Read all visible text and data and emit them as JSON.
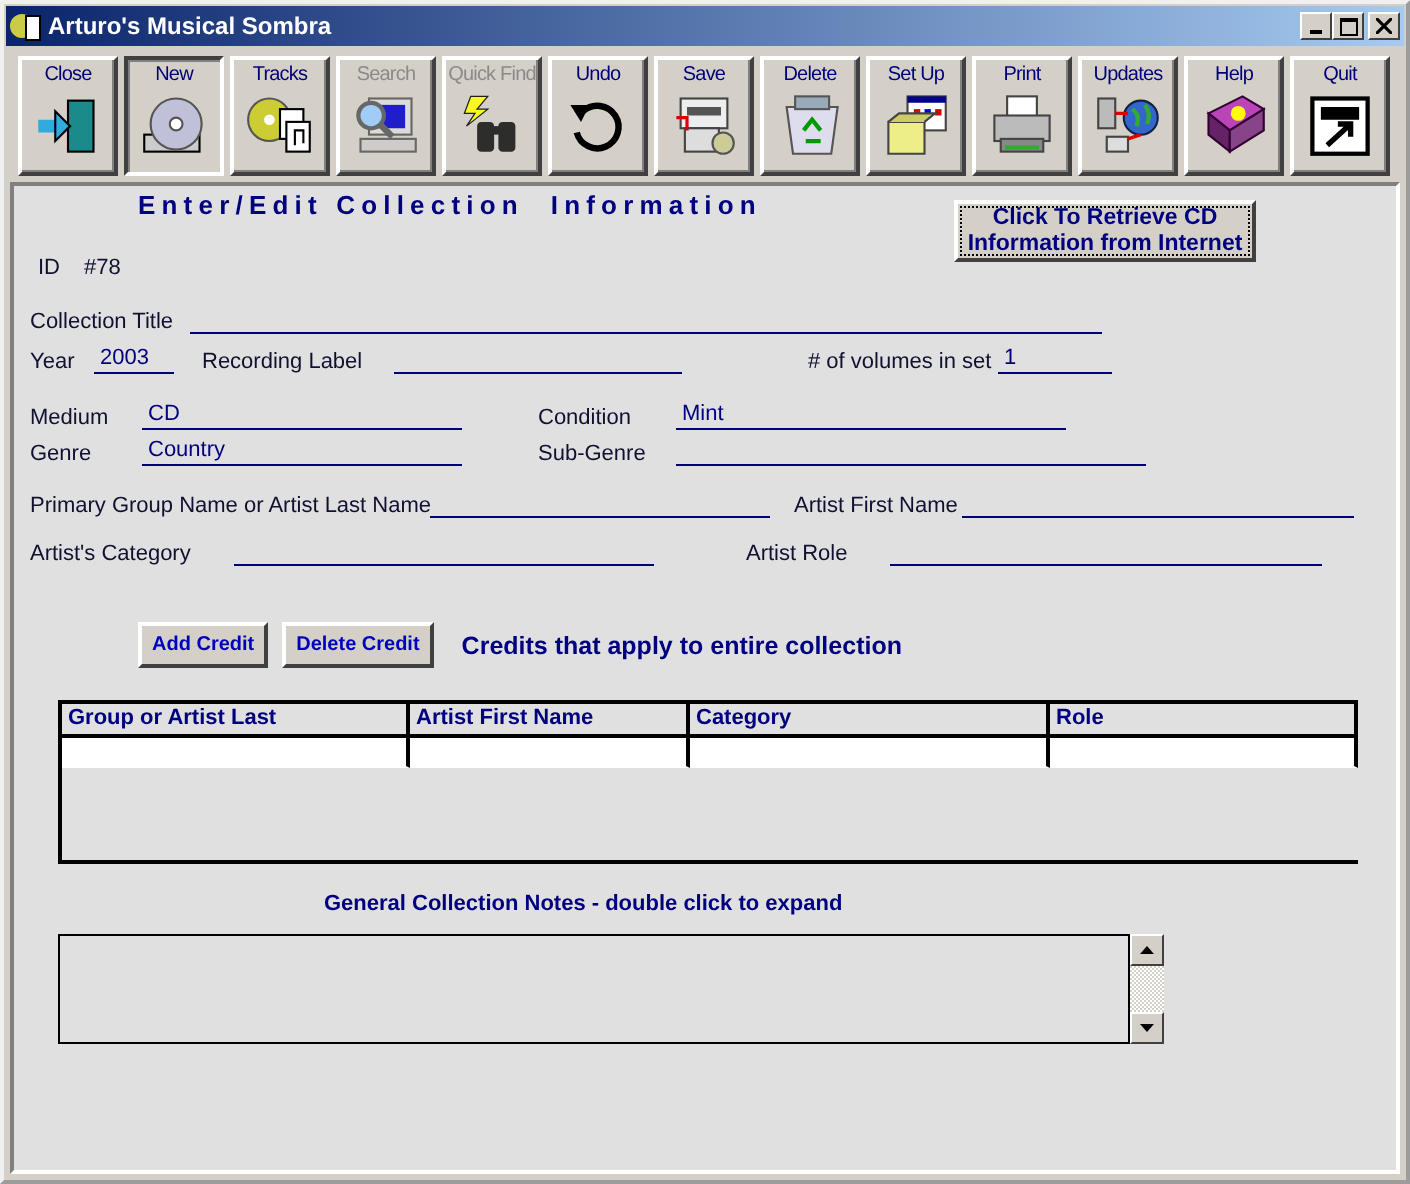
{
  "window": {
    "title": "Arturo's Musical Sombra"
  },
  "toolbar": [
    {
      "label": "Close",
      "disabled": false,
      "pressed": false
    },
    {
      "label": "New",
      "disabled": false,
      "pressed": true
    },
    {
      "label": "Tracks",
      "disabled": false,
      "pressed": false
    },
    {
      "label": "Search",
      "disabled": true,
      "pressed": false
    },
    {
      "label": "Quick Find",
      "disabled": true,
      "pressed": false
    },
    {
      "label": "Undo",
      "disabled": false,
      "pressed": false
    },
    {
      "label": "Save",
      "disabled": false,
      "pressed": false
    },
    {
      "label": "Delete",
      "disabled": false,
      "pressed": false
    },
    {
      "label": "Set Up",
      "disabled": false,
      "pressed": false
    },
    {
      "label": "Print",
      "disabled": false,
      "pressed": false
    },
    {
      "label": "Updates",
      "disabled": false,
      "pressed": false
    },
    {
      "label": "Help",
      "disabled": false,
      "pressed": false
    },
    {
      "label": "Quit",
      "disabled": false,
      "pressed": false
    }
  ],
  "heading": "Enter/Edit Collection  Information",
  "retrieve_button": [
    "Click To Retrieve CD",
    "Information from Internet"
  ],
  "id": {
    "label": "ID",
    "value": "#78"
  },
  "form_rows": [
    [
      {
        "label": "Collection Title"
      }
    ],
    [
      {
        "label": "Year",
        "value": "2003"
      },
      {
        "label": "Recording Label"
      },
      {
        "label": "# of volumes in set",
        "value": "1"
      }
    ],
    [
      {
        "label": "Medium",
        "value": "CD"
      },
      {
        "label": "Condition",
        "value": "Mint"
      }
    ],
    [
      {
        "label": "Genre",
        "value": "Country"
      },
      {
        "label": "Sub-Genre"
      }
    ],
    [
      {
        "label": "Primary Group Name or Artist Last Name"
      },
      {
        "label": "Artist First Name"
      }
    ],
    [
      {
        "label": "Artist's  Category"
      },
      {
        "label": "Artist Role"
      }
    ]
  ],
  "credit_buttons": [
    "Add Credit",
    "Delete Credit"
  ],
  "credits_caption": "Credits that apply to entire collection",
  "table": {
    "columns": [
      "Group or Artist Last",
      "Artist First Name",
      "Category",
      "Role"
    ]
  },
  "notes": {
    "label": "General Collection Notes  - double click to expand"
  }
}
